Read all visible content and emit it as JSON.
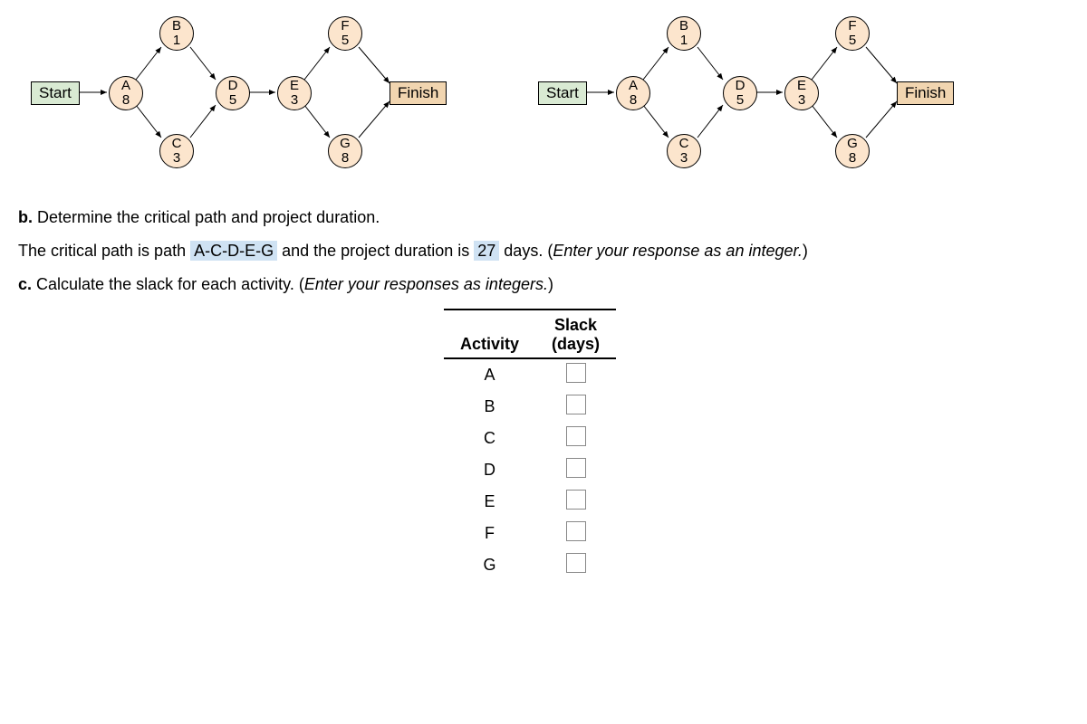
{
  "diagram": {
    "start": "Start",
    "finish": "Finish",
    "nodes": {
      "A": {
        "label": "A",
        "value": "8"
      },
      "B": {
        "label": "B",
        "value": "1"
      },
      "C": {
        "label": "C",
        "value": "3"
      },
      "D": {
        "label": "D",
        "value": "5"
      },
      "E": {
        "label": "E",
        "value": "3"
      },
      "F": {
        "label": "F",
        "value": "5"
      },
      "G": {
        "label": "G",
        "value": "8"
      }
    }
  },
  "questions": {
    "b_prompt": "Determine the critical path and project duration.",
    "b_label": "b.",
    "b_answer_pre": "The critical path is path ",
    "b_path": "A-C-D-E-G",
    "b_answer_mid": " and the project duration is ",
    "b_days": "27",
    "b_answer_post": " days. (",
    "b_hint": "Enter your response as an integer.",
    "b_close": ")",
    "c_label": "c.",
    "c_prompt": "Calculate the slack for each activity. (",
    "c_hint": "Enter your responses as integers.",
    "c_close": ")"
  },
  "table": {
    "col1": "Activity",
    "col2a": "Slack",
    "col2b": "(days)",
    "rows": [
      "A",
      "B",
      "C",
      "D",
      "E",
      "F",
      "G"
    ]
  }
}
